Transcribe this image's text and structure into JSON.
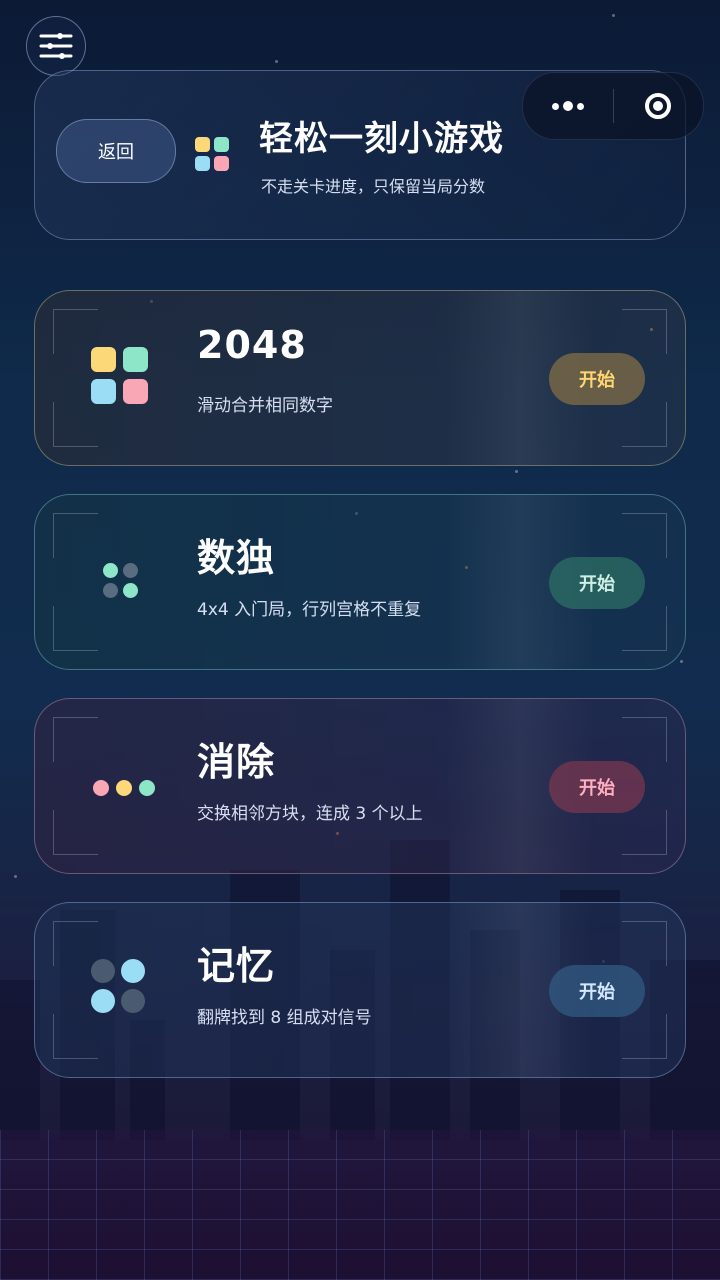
{
  "colors": {
    "yellow": "#FDD878",
    "mint": "#8EE6C8",
    "sky": "#9ADDF5",
    "pink": "#F9A7B5",
    "slate": "#5A6D80"
  },
  "toolbar": {
    "menu_icon": "sliders-menu-icon",
    "more_icon": "more-dots-icon",
    "close_icon": "target-icon"
  },
  "header": {
    "back_label": "返回",
    "title": "轻松一刻小游戏",
    "subtitle": "不走关卡进度，只保留当局分数",
    "icon": "grid-icon"
  },
  "games": [
    {
      "title": "2048",
      "desc": "滑动合并相同数字",
      "start_label": "开始",
      "icon": "tiles-grid-icon"
    },
    {
      "title": "数独",
      "desc": "4x4 入门局，行列宫格不重复",
      "start_label": "开始",
      "icon": "dots-grid-icon"
    },
    {
      "title": "消除",
      "desc": "交换相邻方块，连成 3 个以上",
      "start_label": "开始",
      "icon": "three-dots-icon"
    },
    {
      "title": "记忆",
      "desc": "翻牌找到 8 组成对信号",
      "start_label": "开始",
      "icon": "memory-cards-icon"
    }
  ]
}
